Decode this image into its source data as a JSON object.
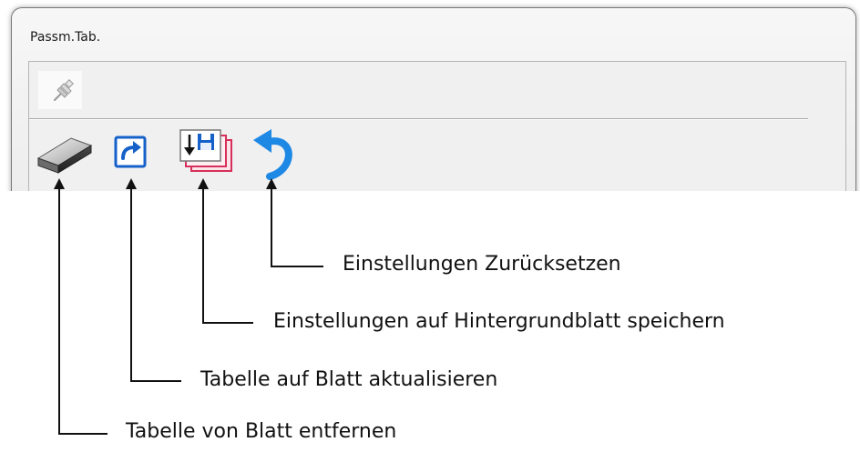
{
  "window": {
    "title": "Passm.Tab."
  },
  "toolbar": {
    "pin": {
      "icon": "pin-icon"
    },
    "buttons": [
      {
        "id": "remove",
        "icon": "eraser-icon"
      },
      {
        "id": "refresh",
        "icon": "refresh-icon"
      },
      {
        "id": "save",
        "icon": "save-to-background-icon"
      },
      {
        "id": "reset",
        "icon": "undo-arrow-icon"
      }
    ]
  },
  "callouts": {
    "reset": "Einstellungen Zurücksetzen",
    "save": "Einstellungen auf Hintergrundblatt speichern",
    "refresh": "Tabelle auf Blatt aktualisieren",
    "remove": "Tabelle von Blatt entfernen"
  },
  "colors": {
    "line": "#111111",
    "window_border": "#7a7a7a",
    "panel_bg": "#f0f0f0",
    "refresh_blue": "#1560c9",
    "undo_blue": "#1e88e5",
    "save_red": "#d6305a"
  }
}
